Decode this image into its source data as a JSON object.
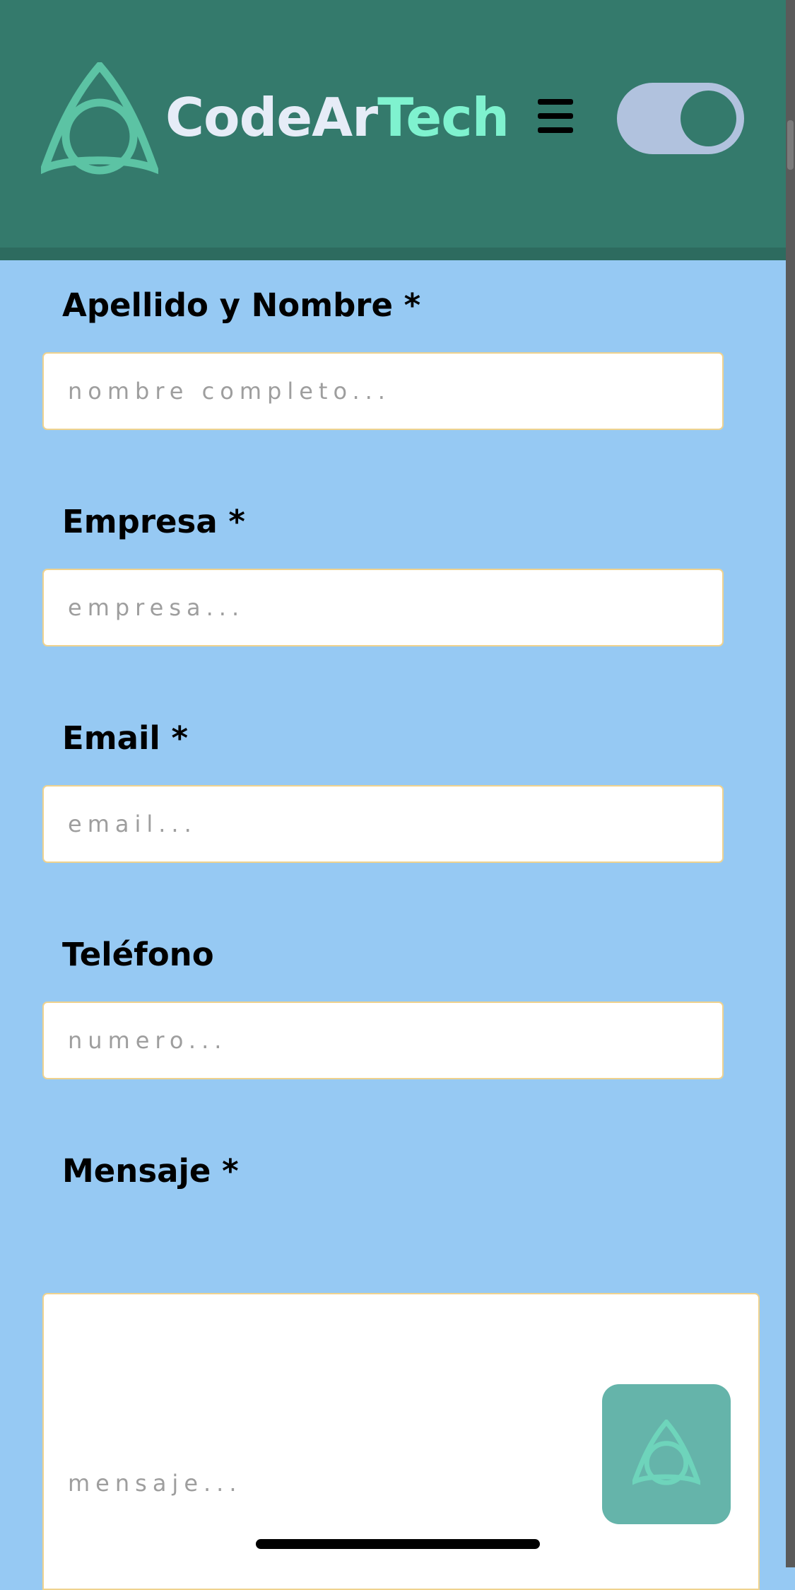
{
  "header": {
    "logo_icon": "triquetra-knot-icon",
    "brand_part1": "CodeAr",
    "brand_part2": "Tech",
    "menu_icon": "hamburger-menu-icon",
    "theme_toggle_icon": "toggle-switch-icon",
    "colors": {
      "bar": "#347a6c",
      "brand_light": "#e6ecf7",
      "brand_accent": "#7ff2cf",
      "toggle_track": "#b1c2de"
    }
  },
  "form": {
    "fields": [
      {
        "label": "Apellido y Nombre *",
        "placeholder": "nombre completo..."
      },
      {
        "label": "Empresa *",
        "placeholder": "empresa..."
      },
      {
        "label": "Email *",
        "placeholder": "email..."
      },
      {
        "label": "Teléfono",
        "placeholder": "numero..."
      }
    ],
    "message": {
      "label": "Mensaje *",
      "placeholder": "mensaje..."
    },
    "colors": {
      "background": "#96c9f3",
      "input_border": "#efd28e"
    }
  },
  "fab": {
    "icon": "triquetra-knot-icon",
    "color": "#65b4aa"
  }
}
